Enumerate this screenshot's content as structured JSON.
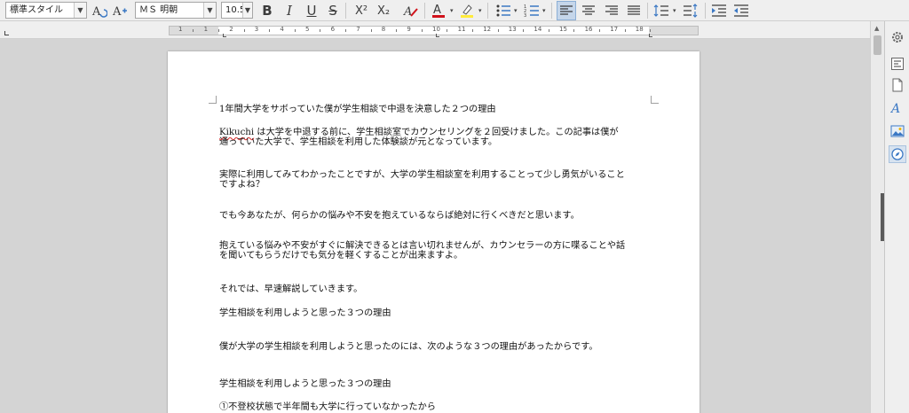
{
  "toolbar": {
    "paragraph_style": "標準スタイル",
    "font_name": "ＭＳ 明朝",
    "font_size": "10.5",
    "icons": [
      "update-style-icon",
      "new-style-icon",
      "bold-icon",
      "italic-icon",
      "underline-icon",
      "strikethrough-icon",
      "superscript-icon",
      "subscript-icon",
      "clear-formatting-icon",
      "font-color-icon",
      "highlight-icon",
      "bullet-list-icon",
      "numbered-list-icon",
      "align-left-icon",
      "align-center-icon",
      "align-right-icon",
      "justify-icon",
      "line-spacing-icon",
      "paragraph-spacing-icon",
      "increase-indent-icon",
      "decrease-indent-icon"
    ],
    "bold": "B",
    "italic": "I",
    "underline": "U",
    "strike": "S",
    "superscript": "X²",
    "subscript": "X₂",
    "font_color": "A",
    "colors": {
      "font_color": "#d0121b",
      "highlight": "#ffeb3b",
      "active_bg": "#c5d6ea"
    }
  },
  "ruler": {
    "numbers": [
      "1",
      "1",
      "2",
      "3",
      "4",
      "5",
      "6",
      "7",
      "8",
      "9",
      "10",
      "11",
      "12",
      "13",
      "14",
      "15",
      "16",
      "17",
      "18"
    ]
  },
  "document": {
    "paragraphs": [
      {
        "lines": [
          "1年間大学をサボっていた僕が学生相談で中退を決意した２つの理由"
        ]
      },
      {
        "lines": [
          "Kikuchi は大学を中退する前に、学生相談室でカウンセリングを２回受けました。この記事は僕が",
          "通っていた大学で、学生相談を利用した体験談が元となっています。"
        ],
        "squiggle_word": "Kikuchi"
      },
      {
        "lines": [
          "実際に利用してみてわかったことですが、大学の学生相談室を利用することって少し勇気がいること",
          "ですよね？"
        ]
      },
      {
        "lines": [
          "でも今あなたが、何らかの悩みや不安を抱えているならば絶対に行くべきだと思います。"
        ]
      },
      {
        "lines": [
          "抱えている悩みや不安がすぐに解決できるとは言い切れませんが、カウンセラーの方に喋ることや話",
          "を聞いてもらうだけでも気分を軽くすることが出来ますよ。"
        ]
      },
      {
        "lines": [
          "それでは、早速解説していきます。"
        ]
      },
      {
        "lines": [
          "学生相談を利用しようと思った３つの理由"
        ]
      },
      {
        "lines": [
          "僕が大学の学生相談を利用しようと思ったのには、次のような３つの理由があったからです。"
        ]
      },
      {
        "lines": [
          "学生相談を利用しようと思った３つの理由"
        ]
      },
      {
        "lines": [
          "①不登校状態で半年間も大学に行っていなかったから"
        ]
      }
    ]
  },
  "sidebar": {
    "icons": [
      "properties-icon",
      "page-icon",
      "styles-icon",
      "gallery-icon",
      "navigator-icon",
      "settings-icon"
    ]
  }
}
